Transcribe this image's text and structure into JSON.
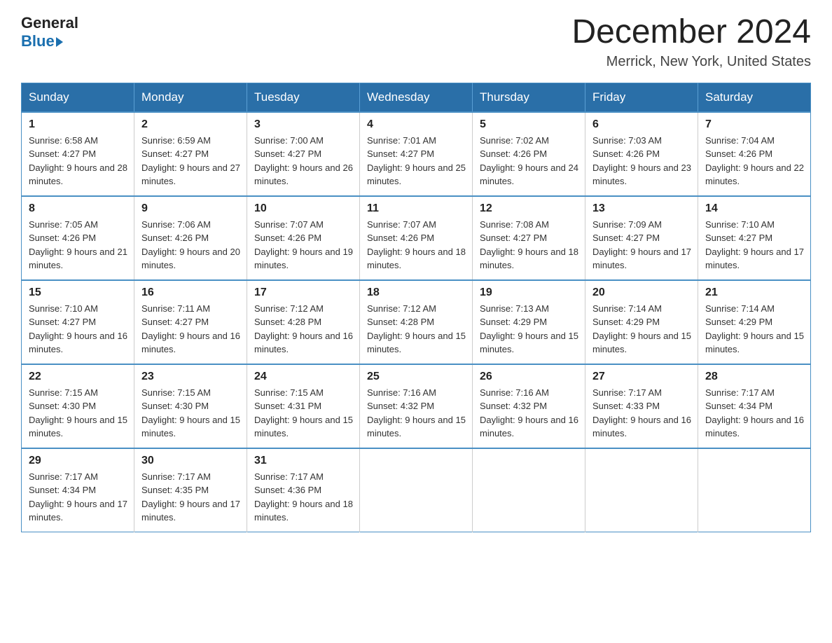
{
  "header": {
    "logo_general": "General",
    "logo_blue": "Blue",
    "month_title": "December 2024",
    "location": "Merrick, New York, United States"
  },
  "weekdays": [
    "Sunday",
    "Monday",
    "Tuesday",
    "Wednesday",
    "Thursday",
    "Friday",
    "Saturday"
  ],
  "weeks": [
    [
      {
        "day": "1",
        "sunrise": "6:58 AM",
        "sunset": "4:27 PM",
        "daylight": "9 hours and 28 minutes."
      },
      {
        "day": "2",
        "sunrise": "6:59 AM",
        "sunset": "4:27 PM",
        "daylight": "9 hours and 27 minutes."
      },
      {
        "day": "3",
        "sunrise": "7:00 AM",
        "sunset": "4:27 PM",
        "daylight": "9 hours and 26 minutes."
      },
      {
        "day": "4",
        "sunrise": "7:01 AM",
        "sunset": "4:27 PM",
        "daylight": "9 hours and 25 minutes."
      },
      {
        "day": "5",
        "sunrise": "7:02 AM",
        "sunset": "4:26 PM",
        "daylight": "9 hours and 24 minutes."
      },
      {
        "day": "6",
        "sunrise": "7:03 AM",
        "sunset": "4:26 PM",
        "daylight": "9 hours and 23 minutes."
      },
      {
        "day": "7",
        "sunrise": "7:04 AM",
        "sunset": "4:26 PM",
        "daylight": "9 hours and 22 minutes."
      }
    ],
    [
      {
        "day": "8",
        "sunrise": "7:05 AM",
        "sunset": "4:26 PM",
        "daylight": "9 hours and 21 minutes."
      },
      {
        "day": "9",
        "sunrise": "7:06 AM",
        "sunset": "4:26 PM",
        "daylight": "9 hours and 20 minutes."
      },
      {
        "day": "10",
        "sunrise": "7:07 AM",
        "sunset": "4:26 PM",
        "daylight": "9 hours and 19 minutes."
      },
      {
        "day": "11",
        "sunrise": "7:07 AM",
        "sunset": "4:26 PM",
        "daylight": "9 hours and 18 minutes."
      },
      {
        "day": "12",
        "sunrise": "7:08 AM",
        "sunset": "4:27 PM",
        "daylight": "9 hours and 18 minutes."
      },
      {
        "day": "13",
        "sunrise": "7:09 AM",
        "sunset": "4:27 PM",
        "daylight": "9 hours and 17 minutes."
      },
      {
        "day": "14",
        "sunrise": "7:10 AM",
        "sunset": "4:27 PM",
        "daylight": "9 hours and 17 minutes."
      }
    ],
    [
      {
        "day": "15",
        "sunrise": "7:10 AM",
        "sunset": "4:27 PM",
        "daylight": "9 hours and 16 minutes."
      },
      {
        "day": "16",
        "sunrise": "7:11 AM",
        "sunset": "4:27 PM",
        "daylight": "9 hours and 16 minutes."
      },
      {
        "day": "17",
        "sunrise": "7:12 AM",
        "sunset": "4:28 PM",
        "daylight": "9 hours and 16 minutes."
      },
      {
        "day": "18",
        "sunrise": "7:12 AM",
        "sunset": "4:28 PM",
        "daylight": "9 hours and 15 minutes."
      },
      {
        "day": "19",
        "sunrise": "7:13 AM",
        "sunset": "4:29 PM",
        "daylight": "9 hours and 15 minutes."
      },
      {
        "day": "20",
        "sunrise": "7:14 AM",
        "sunset": "4:29 PM",
        "daylight": "9 hours and 15 minutes."
      },
      {
        "day": "21",
        "sunrise": "7:14 AM",
        "sunset": "4:29 PM",
        "daylight": "9 hours and 15 minutes."
      }
    ],
    [
      {
        "day": "22",
        "sunrise": "7:15 AM",
        "sunset": "4:30 PM",
        "daylight": "9 hours and 15 minutes."
      },
      {
        "day": "23",
        "sunrise": "7:15 AM",
        "sunset": "4:30 PM",
        "daylight": "9 hours and 15 minutes."
      },
      {
        "day": "24",
        "sunrise": "7:15 AM",
        "sunset": "4:31 PM",
        "daylight": "9 hours and 15 minutes."
      },
      {
        "day": "25",
        "sunrise": "7:16 AM",
        "sunset": "4:32 PM",
        "daylight": "9 hours and 15 minutes."
      },
      {
        "day": "26",
        "sunrise": "7:16 AM",
        "sunset": "4:32 PM",
        "daylight": "9 hours and 16 minutes."
      },
      {
        "day": "27",
        "sunrise": "7:17 AM",
        "sunset": "4:33 PM",
        "daylight": "9 hours and 16 minutes."
      },
      {
        "day": "28",
        "sunrise": "7:17 AM",
        "sunset": "4:34 PM",
        "daylight": "9 hours and 16 minutes."
      }
    ],
    [
      {
        "day": "29",
        "sunrise": "7:17 AM",
        "sunset": "4:34 PM",
        "daylight": "9 hours and 17 minutes."
      },
      {
        "day": "30",
        "sunrise": "7:17 AM",
        "sunset": "4:35 PM",
        "daylight": "9 hours and 17 minutes."
      },
      {
        "day": "31",
        "sunrise": "7:17 AM",
        "sunset": "4:36 PM",
        "daylight": "9 hours and 18 minutes."
      },
      null,
      null,
      null,
      null
    ]
  ]
}
